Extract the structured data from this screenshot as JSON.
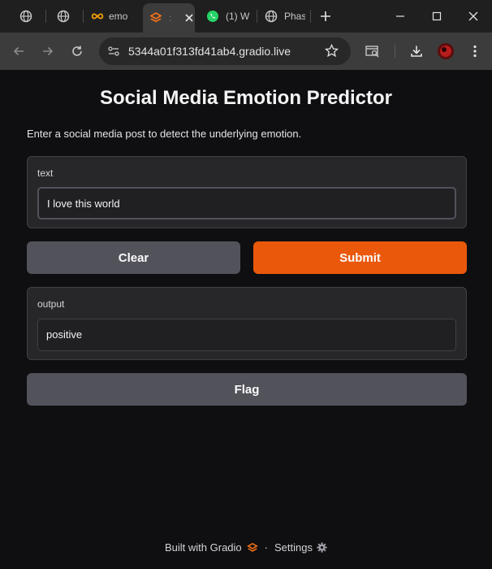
{
  "browser": {
    "tabs": [
      {
        "label": "",
        "icon": "globe-icon"
      },
      {
        "label": "",
        "icon": "globe-icon"
      },
      {
        "label": "emo",
        "icon": "infinity-icon"
      },
      {
        "label": "",
        "icon": "gradio-icon"
      },
      {
        "label": "(1) W",
        "icon": "whatsapp-icon"
      },
      {
        "label": "Phas",
        "icon": "globe-icon"
      }
    ],
    "url": "5344a01f313fd41ab4.gradio.live"
  },
  "app": {
    "title": "Social Media Emotion Predictor",
    "description": "Enter a social media post to detect the underlying emotion.",
    "input_label": "text",
    "input_value": "I love this world",
    "clear_label": "Clear",
    "submit_label": "Submit",
    "output_label": "output",
    "output_value": "positive",
    "flag_label": "Flag"
  },
  "footer": {
    "built_with": "Built with Gradio",
    "separator": "·",
    "settings": "Settings"
  },
  "colors": {
    "primary": "#ea580c",
    "secondary": "#52525b",
    "background": "#0f0f11"
  }
}
